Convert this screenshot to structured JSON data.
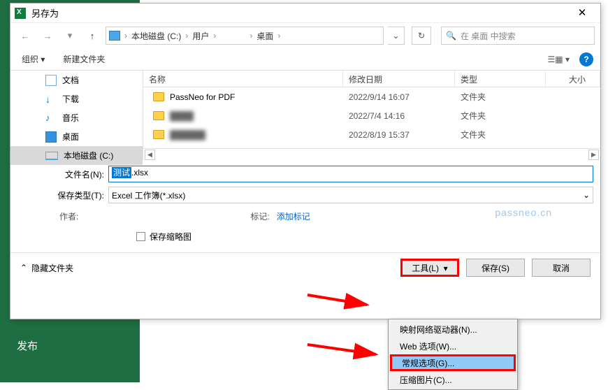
{
  "dialog": {
    "title": "另存为",
    "close": "✕"
  },
  "nav": {
    "back": "←",
    "forward": "→",
    "dropdown": "▾",
    "up": "↑",
    "refresh": "↻",
    "path_drop": "⌄"
  },
  "breadcrumb": {
    "sep": "›",
    "items": [
      "本地磁盘 (C:)",
      "用户",
      "　　　",
      "桌面"
    ]
  },
  "search": {
    "icon": "🔍",
    "placeholder": "在 桌面 中搜索"
  },
  "toolbar": {
    "organize": "组织 ▾",
    "new_folder": "新建文件夹",
    "view_icon": "☰▦ ▾",
    "help": "?"
  },
  "tree": [
    {
      "icon": "doc",
      "label": "文档"
    },
    {
      "icon": "dl",
      "glyph": "↓",
      "label": "下载"
    },
    {
      "icon": "music",
      "glyph": "♪",
      "label": "音乐"
    },
    {
      "icon": "desk",
      "label": "桌面"
    },
    {
      "icon": "disk",
      "label": "本地磁盘 (C:)",
      "sel": true
    }
  ],
  "columns": {
    "name": "名称",
    "date": "修改日期",
    "type": "类型",
    "size": "大小"
  },
  "files": [
    {
      "name": "PassNeo for PDF",
      "date": "2022/9/14 16:07",
      "type": "文件夹"
    },
    {
      "name": "████",
      "date": "2022/7/4 14:16",
      "type": "文件夹",
      "blur": true
    },
    {
      "name": "██████",
      "date": "2022/8/19 15:37",
      "type": "文件夹",
      "blur": true
    }
  ],
  "form": {
    "filename_label": "文件名(N):",
    "filename_value": "测试",
    "filename_ext": ".xlsx",
    "filetype_label": "保存类型(T):",
    "filetype_value": "Excel 工作簿(*.xlsx)",
    "author_label": "作者:",
    "author_value": "　　　",
    "tags_label": "标记:",
    "tags_link": "添加标记",
    "thumbnail": "保存缩略图"
  },
  "bottom": {
    "hide": "隐藏文件夹",
    "tools": "工具(L)",
    "save": "保存(S)",
    "cancel": "取消",
    "caret": "▾",
    "chev": "⌃"
  },
  "menu": [
    "映射网络驱动器(N)...",
    "Web 选项(W)...",
    "常规选项(G)...",
    "压缩图片(C)..."
  ],
  "bg_publish": "发布",
  "watermark": "passneo.cn"
}
